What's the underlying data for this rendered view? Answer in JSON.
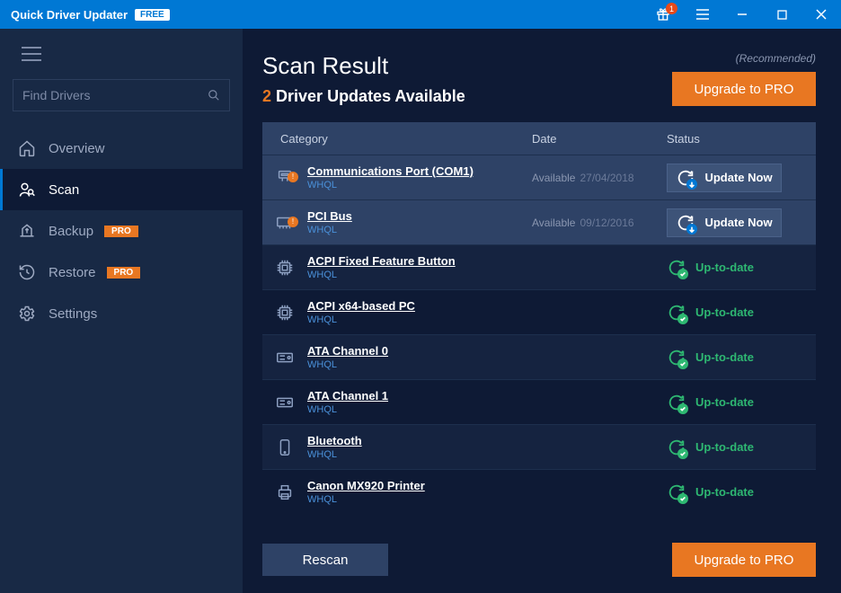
{
  "titlebar": {
    "app_name": "Quick Driver Updater",
    "free_label": "FREE",
    "gift_count": "1"
  },
  "sidebar": {
    "search_placeholder": "Find Drivers",
    "items": [
      {
        "label": "Overview",
        "icon": "home",
        "active": false,
        "pro": false
      },
      {
        "label": "Scan",
        "icon": "scan",
        "active": true,
        "pro": false
      },
      {
        "label": "Backup",
        "icon": "backup",
        "active": false,
        "pro": true
      },
      {
        "label": "Restore",
        "icon": "restore",
        "active": false,
        "pro": true
      },
      {
        "label": "Settings",
        "icon": "settings",
        "active": false,
        "pro": false
      }
    ],
    "pro_label": "PRO"
  },
  "main": {
    "title": "Scan Result",
    "updates_count": "2",
    "updates_text": "Driver Updates Available",
    "recommended": "(Recommended)",
    "upgrade_label": "Upgrade to PRO",
    "rescan_label": "Rescan",
    "columns": {
      "category": "Category",
      "date": "Date",
      "status": "Status"
    },
    "available_label": "Available",
    "update_now_label": "Update Now",
    "uptodate_label": "Up-to-date",
    "whql_label": "WHQL",
    "rows": [
      {
        "name": "Communications Port (COM1)",
        "date": "27/04/2018",
        "status": "update",
        "icon": "port",
        "alert": true
      },
      {
        "name": "PCI Bus",
        "date": "09/12/2016",
        "status": "update",
        "icon": "pci",
        "alert": true
      },
      {
        "name": "ACPI Fixed Feature Button",
        "date": "",
        "status": "ok",
        "icon": "chip",
        "alert": false
      },
      {
        "name": "ACPI x64-based PC",
        "date": "",
        "status": "ok",
        "icon": "chip",
        "alert": false
      },
      {
        "name": "ATA Channel 0",
        "date": "",
        "status": "ok",
        "icon": "drive",
        "alert": false
      },
      {
        "name": "ATA Channel 1",
        "date": "",
        "status": "ok",
        "icon": "drive",
        "alert": false
      },
      {
        "name": "Bluetooth",
        "date": "",
        "status": "ok",
        "icon": "bluetooth",
        "alert": false
      },
      {
        "name": "Canon MX920 Printer",
        "date": "",
        "status": "ok",
        "icon": "printer",
        "alert": false
      }
    ]
  }
}
